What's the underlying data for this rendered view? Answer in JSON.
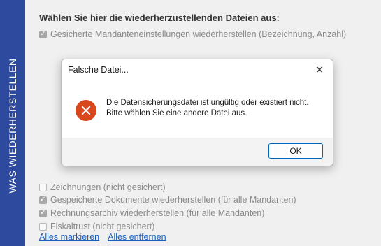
{
  "sidebar": {
    "label": "WAS WIEDERHERSTELLEN"
  },
  "main": {
    "heading": "Wählen Sie hier die wiederherzustellenden Dateien aus:",
    "options_top": [
      {
        "label": "Gesicherte Mandanteneinstellungen wiederherstellen (Bezeichnung, Anzahl)",
        "checked": true
      }
    ],
    "options_bottom": [
      {
        "label": "Zeichnungen (nicht gesichert)",
        "checked": false
      },
      {
        "label": "Gespeicherte Dokumente wiederherstellen (für alle Mandanten)",
        "checked": true
      },
      {
        "label": "Rechnungsarchiv wiederherstellen (für alle Mandanten)",
        "checked": true
      },
      {
        "label": "Fiskaltrust (nicht gesichert)",
        "checked": false
      }
    ],
    "links": {
      "select_all": "Alles markieren",
      "remove_all": "Alles entfernen"
    }
  },
  "dialog": {
    "title": "Falsche Datei...",
    "close_glyph": "✕",
    "message_line1": "Die Datensicherungsdatei ist ungültig oder existiert nicht.",
    "message_line2": "Bitte wählen Sie eine andere Datei aus.",
    "ok_label": "OK",
    "icon": "error-icon",
    "icon_color": "#d9481c"
  },
  "colors": {
    "sidebar": "#2e4a9e",
    "link": "#1a5fbf",
    "accent": "#0067c0"
  }
}
